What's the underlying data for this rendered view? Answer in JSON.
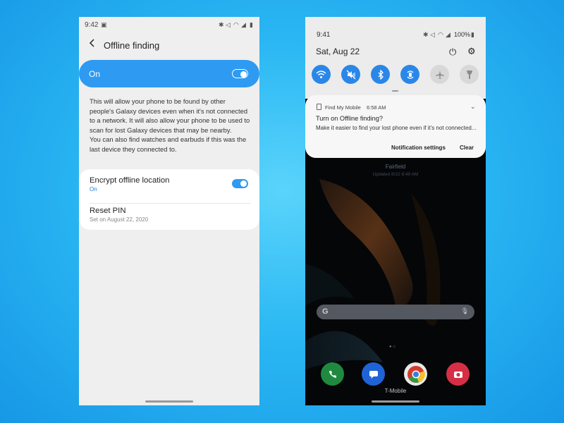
{
  "colors": {
    "background": "#2ab7f3",
    "accent": "#2e9af2",
    "tile_active": "#2a87e8"
  },
  "left_phone": {
    "status_bar": {
      "time": "9:42",
      "icons": [
        "image-icon",
        "bluetooth-icon",
        "mute-icon",
        "wifi-icon",
        "signal-icon",
        "battery-icon"
      ]
    },
    "header": {
      "title": "Offline finding",
      "back_icon": "back-arrow-icon"
    },
    "master_switch": {
      "label": "On",
      "state": true
    },
    "description": [
      "This will allow your phone to be found by other people's Galaxy devices even when it's not connected to a network. It will also allow your phone to be used to scan for lost Galaxy devices that may be nearby.",
      "You can also find watches and earbuds if this was the last device they connected to."
    ],
    "settings": [
      {
        "title": "Encrypt offline location",
        "subtitle": "On",
        "toggle": true
      },
      {
        "title": "Reset PIN",
        "subtitle": "Set on August 22, 2020"
      }
    ]
  },
  "right_phone": {
    "status_bar": {
      "time": "9:41",
      "battery": "100%",
      "icons": [
        "bluetooth-icon",
        "mute-icon",
        "wifi-icon",
        "signal-icon",
        "battery-icon"
      ]
    },
    "quick_panel": {
      "date": "Sat, Aug 22",
      "tiles": [
        {
          "icon": "wifi-icon",
          "active": true
        },
        {
          "icon": "sound-mute-icon",
          "active": true
        },
        {
          "icon": "bluetooth-icon",
          "active": true
        },
        {
          "icon": "auto-rotate-icon",
          "active": true
        },
        {
          "icon": "airplane-mode-icon",
          "active": false
        },
        {
          "icon": "flashlight-icon",
          "active": false
        }
      ]
    },
    "notification": {
      "app": "Find My Mobile",
      "time": "6:58 AM",
      "title": "Turn on Offline finding?",
      "body": "Make it easier to find your lost phone even if it's not connected...",
      "actions": {
        "settings": "Notification settings",
        "clear": "Clear"
      }
    },
    "home": {
      "weather_city": "Fairfield",
      "weather_updated": "Updated 8/22 8:49 AM",
      "carrier": "T-Mobile",
      "dock": [
        "phone-icon",
        "messages-icon",
        "chrome-icon",
        "camera-icon"
      ]
    }
  }
}
